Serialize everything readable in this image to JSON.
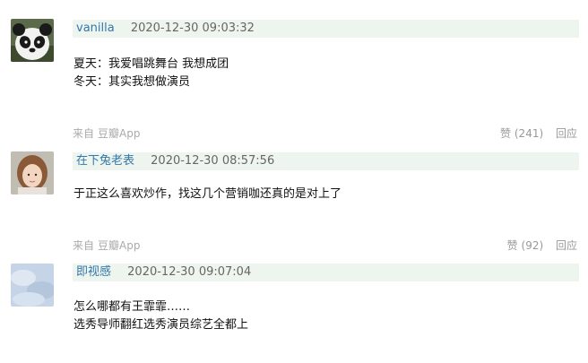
{
  "comments": [
    {
      "author": "vanilla",
      "time": "2020-12-30 09:03:32",
      "lines": [
        "夏天：我爱唱跳舞台 我想成团",
        "冬天：其实我想做演员"
      ],
      "source_prefix": "来自",
      "source": "豆瓣App",
      "vote_label": "赞",
      "vote_count": "(241)",
      "reply_label": "回应"
    },
    {
      "author": "在下兔老表",
      "time": "2020-12-30 08:57:56",
      "lines": [
        "于正这么喜欢炒作，找这几个营销咖还真的是对上了"
      ],
      "source_prefix": "来自",
      "source": "豆瓣App",
      "vote_label": "赞",
      "vote_count": "(92)",
      "reply_label": "回应"
    },
    {
      "author": "即视感",
      "time": "2020-12-30 09:07:04",
      "lines": [
        "怎么哪都有王霏霏……",
        "选秀导师翻红选秀演员综艺全都上"
      ]
    }
  ]
}
